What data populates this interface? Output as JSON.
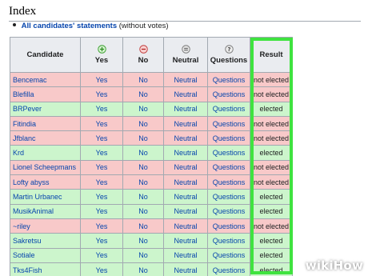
{
  "page": {
    "heading": "Index",
    "summary_link": "All candidates' statements",
    "summary_suffix": "(without votes)"
  },
  "table": {
    "headers": {
      "candidate": "Candidate",
      "yes": "Yes",
      "no": "No",
      "neutral": "Neutral",
      "questions": "Questions",
      "result": "Result"
    },
    "rows": [
      {
        "candidate": "Bencemac",
        "yes": "Yes",
        "no": "No",
        "neutral": "Neutral",
        "questions": "Questions",
        "result": "not elected",
        "status": "lost"
      },
      {
        "candidate": "Blefilla",
        "yes": "Yes",
        "no": "No",
        "neutral": "Neutral",
        "questions": "Questions",
        "result": "not elected",
        "status": "lost"
      },
      {
        "candidate": "BRPever",
        "yes": "Yes",
        "no": "No",
        "neutral": "Neutral",
        "questions": "Questions",
        "result": "elected",
        "status": "won"
      },
      {
        "candidate": "Fitindia",
        "yes": "Yes",
        "no": "No",
        "neutral": "Neutral",
        "questions": "Questions",
        "result": "not elected",
        "status": "lost"
      },
      {
        "candidate": "Jfblanc",
        "yes": "Yes",
        "no": "No",
        "neutral": "Neutral",
        "questions": "Questions",
        "result": "not elected",
        "status": "lost"
      },
      {
        "candidate": "Krd",
        "yes": "Yes",
        "no": "No",
        "neutral": "Neutral",
        "questions": "Questions",
        "result": "elected",
        "status": "won"
      },
      {
        "candidate": "Lionel Scheepmans",
        "yes": "Yes",
        "no": "No",
        "neutral": "Neutral",
        "questions": "Questions",
        "result": "not elected",
        "status": "lost"
      },
      {
        "candidate": "Lofty abyss",
        "yes": "Yes",
        "no": "No",
        "neutral": "Neutral",
        "questions": "Questions",
        "result": "not elected",
        "status": "lost"
      },
      {
        "candidate": "Martin Urbanec",
        "yes": "Yes",
        "no": "No",
        "neutral": "Neutral",
        "questions": "Questions",
        "result": "elected",
        "status": "won"
      },
      {
        "candidate": "MusikAnimal",
        "yes": "Yes",
        "no": "No",
        "neutral": "Neutral",
        "questions": "Questions",
        "result": "elected",
        "status": "won"
      },
      {
        "candidate": "~riley",
        "yes": "Yes",
        "no": "No",
        "neutral": "Neutral",
        "questions": "Questions",
        "result": "not elected",
        "status": "lost"
      },
      {
        "candidate": "Sakretsu",
        "yes": "Yes",
        "no": "No",
        "neutral": "Neutral",
        "questions": "Questions",
        "result": "elected",
        "status": "won"
      },
      {
        "candidate": "Sotiale",
        "yes": "Yes",
        "no": "No",
        "neutral": "Neutral",
        "questions": "Questions",
        "result": "elected",
        "status": "won"
      },
      {
        "candidate": "Tks4Fish",
        "yes": "Yes",
        "no": "No",
        "neutral": "Neutral",
        "questions": "Questions",
        "result": "elected",
        "status": "won"
      }
    ]
  },
  "colors": {
    "link": "#0645ad",
    "lost_row": "#f8c9c9",
    "won_row": "#ccf5cc",
    "highlight": "#3fe33f"
  },
  "icons": {
    "yes": "plus-circle-icon",
    "no": "minus-circle-icon",
    "neutral": "equals-circle-icon",
    "questions": "question-circle-icon"
  },
  "watermark": "wikiHow"
}
